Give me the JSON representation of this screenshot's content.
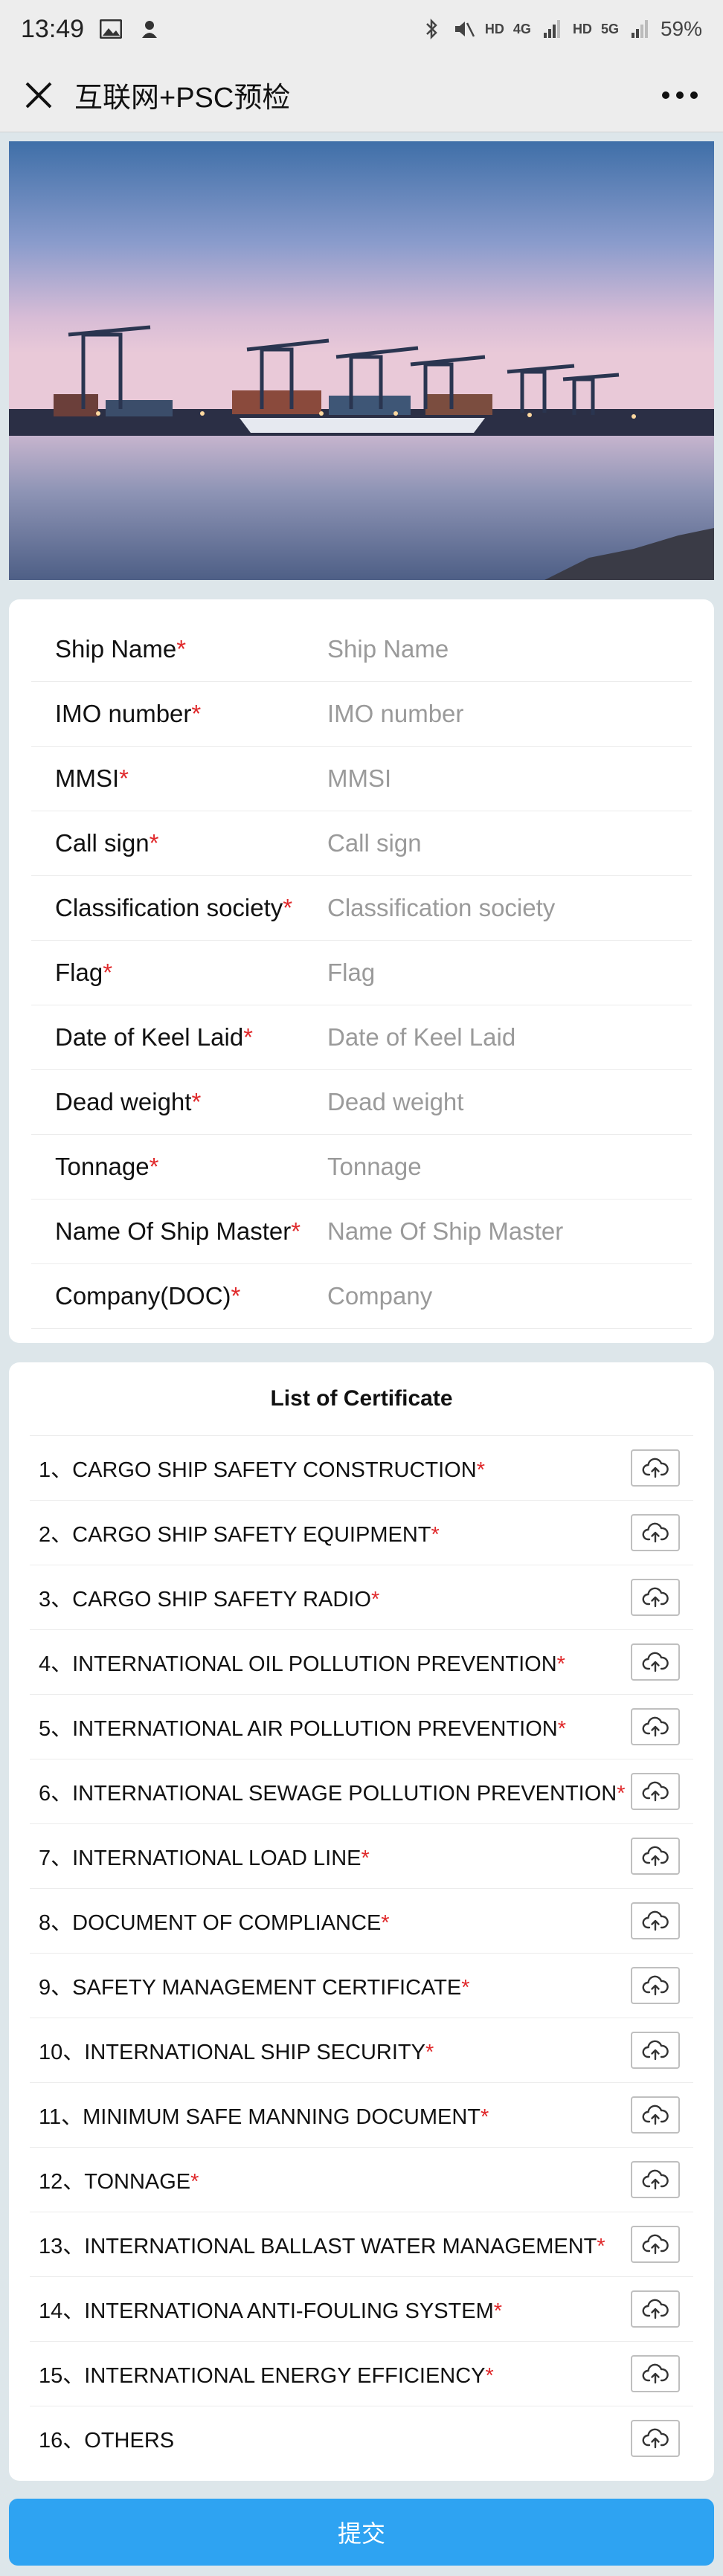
{
  "statusbar": {
    "time": "13:49",
    "hd1": "HD",
    "net1": "4G",
    "hd2": "HD",
    "net2": "5G",
    "battery": "59%"
  },
  "navbar": {
    "title": "互联网+PSC预检"
  },
  "form": {
    "fields": [
      {
        "label": "Ship Name",
        "placeholder": "Ship Name"
      },
      {
        "label": "IMO number",
        "placeholder": "IMO number"
      },
      {
        "label": "MMSI",
        "placeholder": "MMSI"
      },
      {
        "label": "Call sign",
        "placeholder": "Call sign"
      },
      {
        "label": "Classification society",
        "placeholder": "Classification society"
      },
      {
        "label": "Flag",
        "placeholder": "Flag"
      },
      {
        "label": "Date of Keel Laid",
        "placeholder": "Date of Keel Laid"
      },
      {
        "label": "Dead weight",
        "placeholder": "Dead weight"
      },
      {
        "label": "Tonnage",
        "placeholder": "Tonnage"
      },
      {
        "label": "Name Of Ship Master",
        "placeholder": "Name Of Ship Master"
      },
      {
        "label": "Company(DOC)",
        "placeholder": "Company"
      }
    ],
    "required_mark": "*"
  },
  "certificates": {
    "title": "List of Certificate",
    "items": [
      {
        "label": "1、CARGO SHIP SAFETY CONSTRUCTION",
        "req": "*"
      },
      {
        "label": "2、CARGO SHIP SAFETY EQUIPMENT",
        "req": "*"
      },
      {
        "label": "3、CARGO SHIP SAFETY RADIO",
        "req": "*"
      },
      {
        "label": "4、INTERNATIONAL OIL POLLUTION PREVENTION",
        "req": "*"
      },
      {
        "label": "5、INTERNATIONAL AIR POLLUTION PREVENTION",
        "req": "*"
      },
      {
        "label": "6、INTERNATIONAL SEWAGE POLLUTION PREVENTION",
        "req": "*"
      },
      {
        "label": "7、INTERNATIONAL LOAD LINE",
        "req": "*"
      },
      {
        "label": "8、DOCUMENT OF COMPLIANCE",
        "req": "*"
      },
      {
        "label": "9、SAFETY MANAGEMENT CERTIFICATE",
        "req": "*"
      },
      {
        "label": "10、INTERNATIONAL SHIP SECURITY",
        "req": "*"
      },
      {
        "label": "11、MINIMUM SAFE MANNING DOCUMENT",
        "req": "*"
      },
      {
        "label": "12、TONNAGE",
        "req": "*"
      },
      {
        "label": "13、INTERNATIONAL BALLAST WATER MANAGEMENT",
        "req": "*"
      },
      {
        "label": "14、INTERNATIONA ANTI-FOULING SYSTEM",
        "req": "*"
      },
      {
        "label": "15、INTERNATIONAL ENERGY EFFICIENCY",
        "req": "*"
      },
      {
        "label": "16、OTHERS",
        "req": ""
      }
    ]
  },
  "submit": {
    "label": "提交"
  },
  "colors": {
    "accent": "#2ea3f2",
    "required": "#e0292b",
    "background": "#dde6ea"
  },
  "icons": {
    "close": "close-icon",
    "more": "more-icon",
    "upload": "cloud-upload-icon"
  }
}
